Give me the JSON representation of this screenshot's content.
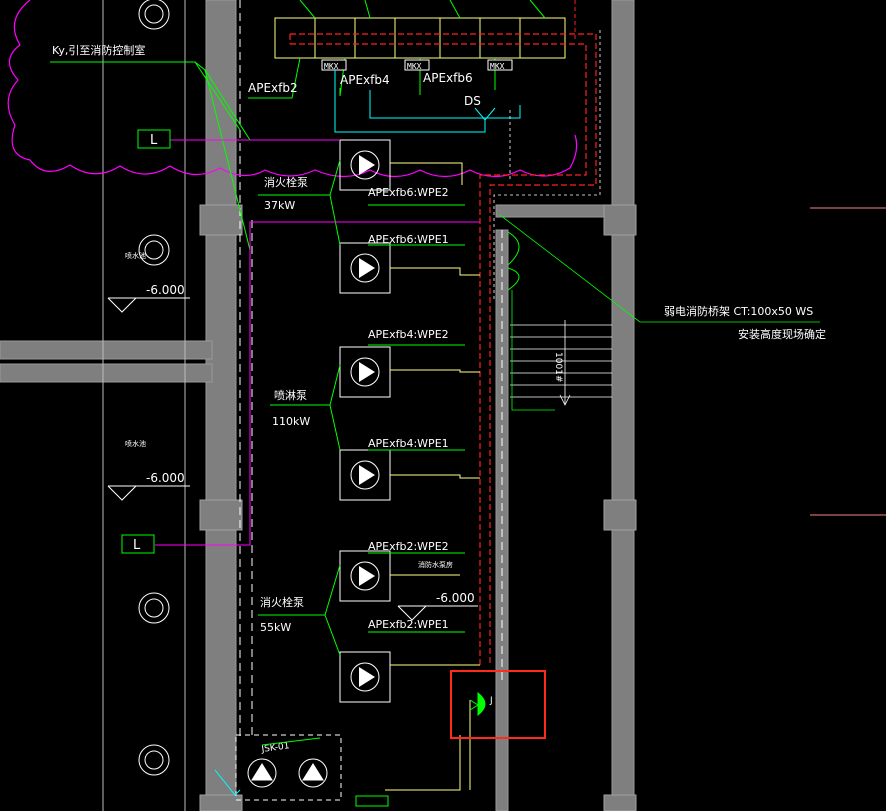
{
  "colors": {
    "background": "#000000",
    "wall": "#808080",
    "green": "#00ff00",
    "magenta": "#ff00ff",
    "red": "#ff2020",
    "yellow": "#ffff80",
    "cyan": "#00ffff",
    "white": "#ffffff",
    "highlight": "#ff2a1a"
  },
  "labels": {
    "ky_note": "Ky,引至消防控制室",
    "l_tag_top": "L",
    "l_tag_bottom": "L",
    "cabinet_apexfb2": "APExfb2",
    "cabinet_apexfb4": "APExfb4",
    "cabinet_apexfb6": "APExfb6",
    "mkx_1": "MKX",
    "mkx_2": "MKX",
    "mkx_3": "MKX",
    "ds": "DS",
    "pump_fire_hydrant_top": "消火栓泵",
    "pump_power_37": "37kW",
    "pump_sprinkler": "喷淋泵",
    "pump_power_110": "110kW",
    "pump_fire_hydrant_bottom": "消火栓泵",
    "pump_power_55": "55kW",
    "wpe2_fb6": "APExfb6:WPE2",
    "wpe1_fb6": "APExfb6:WPE1",
    "wpe2_fb4": "APExfb4:WPE2",
    "wpe1_fb4": "APExfb4:WPE1",
    "wpe2_fb2": "APExfb2:WPE2",
    "wpe1_fb2": "APExfb2:WPE1",
    "level_1": "-6.000",
    "level_2": "-6.000",
    "level_3": "-6.000",
    "pool_1": "喷水池",
    "pool_2": "喷水池",
    "room_small": "消防水泵房",
    "tray_note": "弱电消防桥架 CT:100x50 WS",
    "tray_note2": "安装高度现场确定",
    "stair_dim": "1001#",
    "jsk": "JSK-01",
    "j_symbol": "J"
  }
}
